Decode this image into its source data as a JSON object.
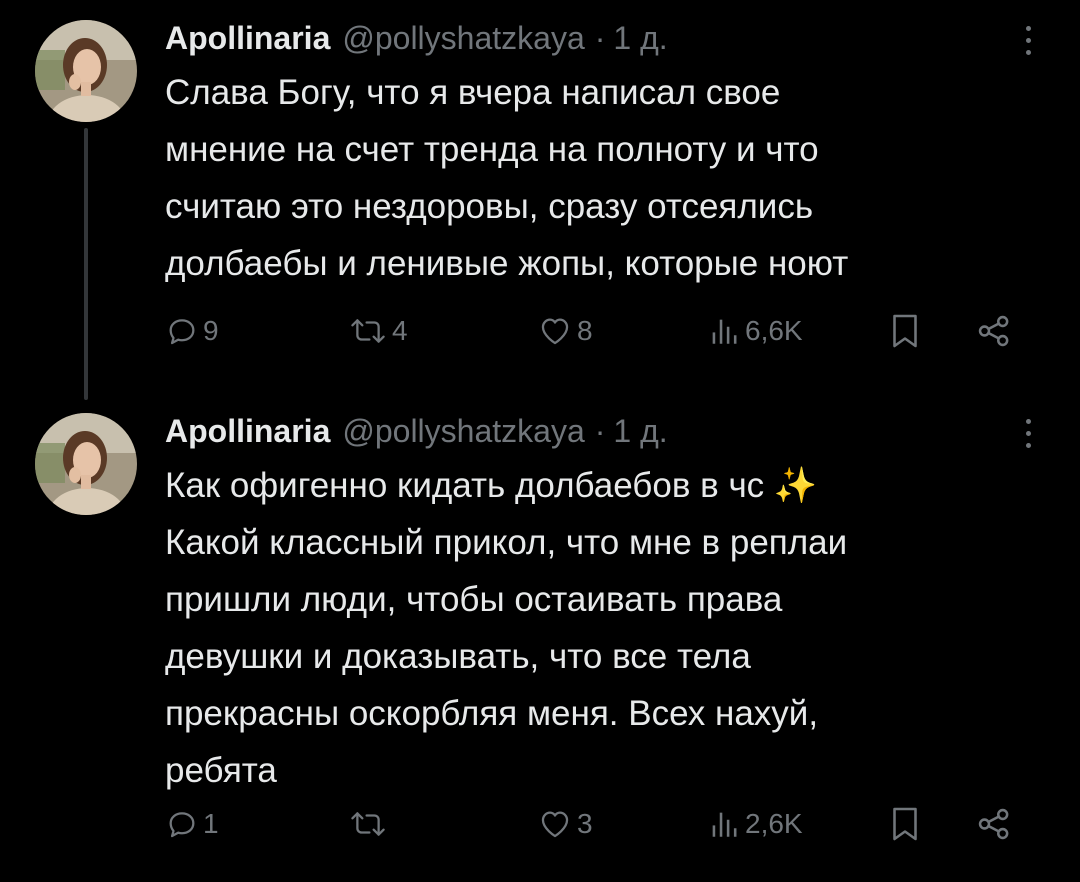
{
  "tweets": [
    {
      "author": {
        "name": "Apollinaria",
        "handle": "@pollyshatzkaya",
        "separator": "·",
        "time": "1 д."
      },
      "lines": [
        "Слава Богу, что я вчера написал свое",
        "мнение на счет тренда на полноту и что",
        "считаю это нездоровы, сразу отсеялись",
        "долбаебы и ленивые жопы, которые ноют"
      ],
      "stats": {
        "replies": "9",
        "retweets": "4",
        "likes": "8",
        "views": "6,6K"
      }
    },
    {
      "author": {
        "name": "Apollinaria",
        "handle": "@pollyshatzkaya",
        "separator": "·",
        "time": "1 д."
      },
      "lines": [
        "Как офигенно кидать долбаебов в чс ✨",
        "Какой классный прикол, что мне в реплаи",
        "пришли люди, чтобы остаивать права",
        "девушки и доказывать, что все тела",
        "прекрасны оскорбляя меня. Всех нахуй,",
        "ребята"
      ],
      "stats": {
        "replies": "1",
        "retweets": "",
        "likes": "3",
        "views": "2,6K"
      }
    }
  ],
  "colors": {
    "background": "#000000",
    "primary_text": "#e7e9ea",
    "secondary_text": "#71767b",
    "thread_line": "#333639"
  },
  "icons": {
    "reply": "reply-icon",
    "retweet": "retweet-icon",
    "like": "heart-icon",
    "views": "views-chart-icon",
    "bookmark": "bookmark-icon",
    "share": "share-icon",
    "more": "more-options-icon"
  }
}
